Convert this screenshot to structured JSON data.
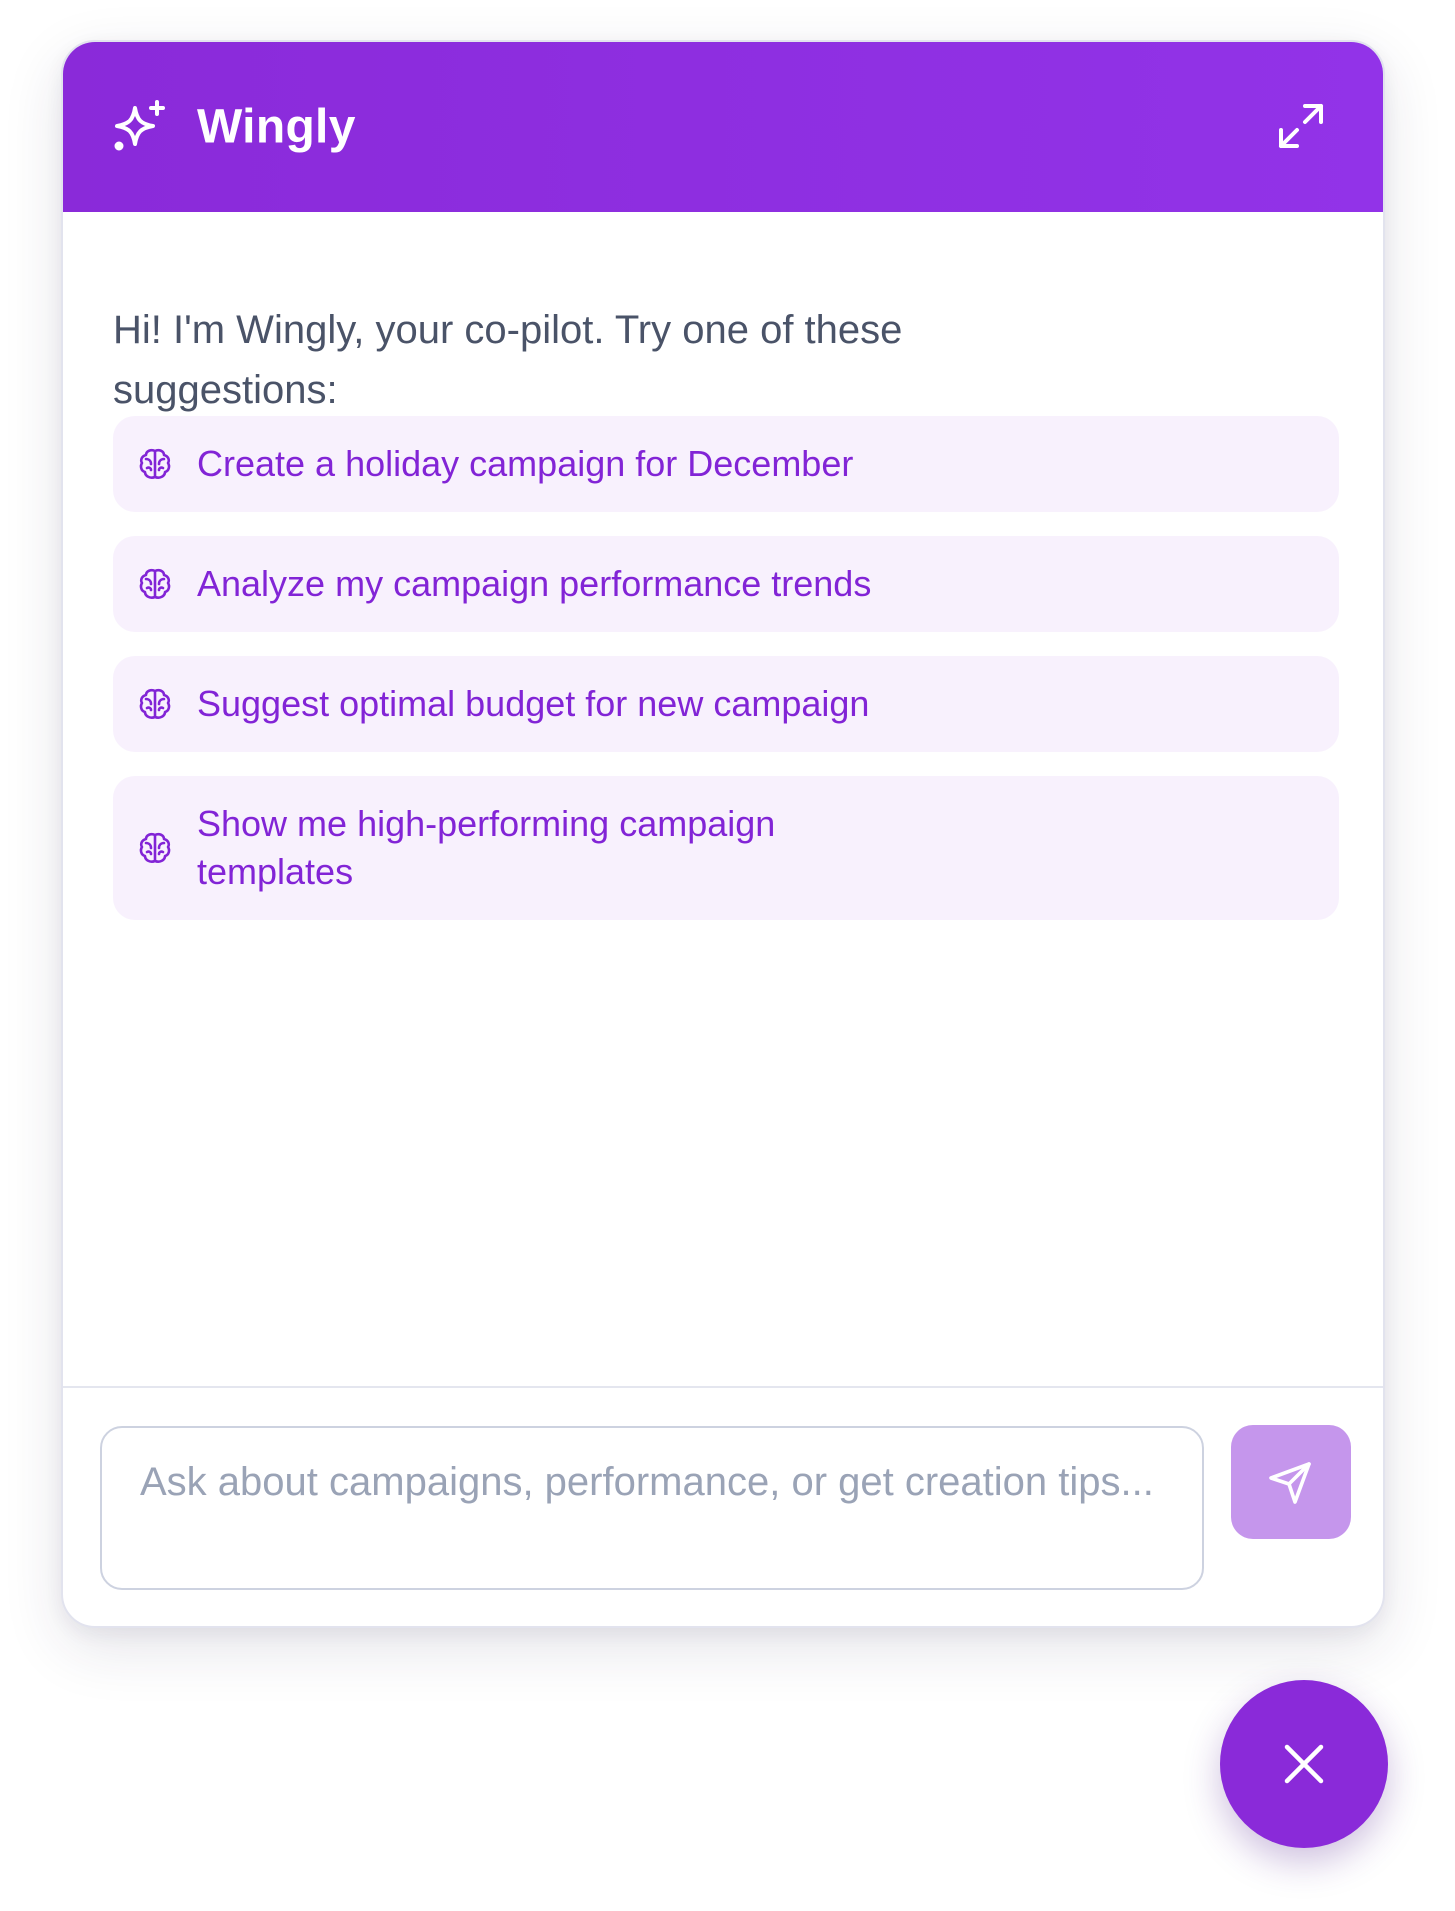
{
  "header": {
    "title": "Wingly",
    "brand_icon": "sparkles-icon",
    "expand_icon": "expand-icon"
  },
  "intro": {
    "text": "Hi! I'm Wingly, your co-pilot. Try one of these suggestions:"
  },
  "suggestions": [
    {
      "label": "Create a holiday campaign for December",
      "icon": "brain-icon"
    },
    {
      "label": "Analyze my campaign performance trends",
      "icon": "brain-icon"
    },
    {
      "label": "Suggest optimal budget for new campaign",
      "icon": "brain-icon"
    },
    {
      "label": "Show me high-performing campaign templates",
      "icon": "brain-icon"
    }
  ],
  "composer": {
    "value": "",
    "placeholder": "Ask about campaigns, performance, or get creation tips...",
    "send_icon": "send-icon"
  },
  "fab": {
    "icon": "close-icon"
  },
  "colors": {
    "accent": "#8a2ad9",
    "suggestion_bg": "#f8f1fd",
    "suggestion_text": "#8224d6",
    "send_button_disabled": "#c596ec"
  }
}
